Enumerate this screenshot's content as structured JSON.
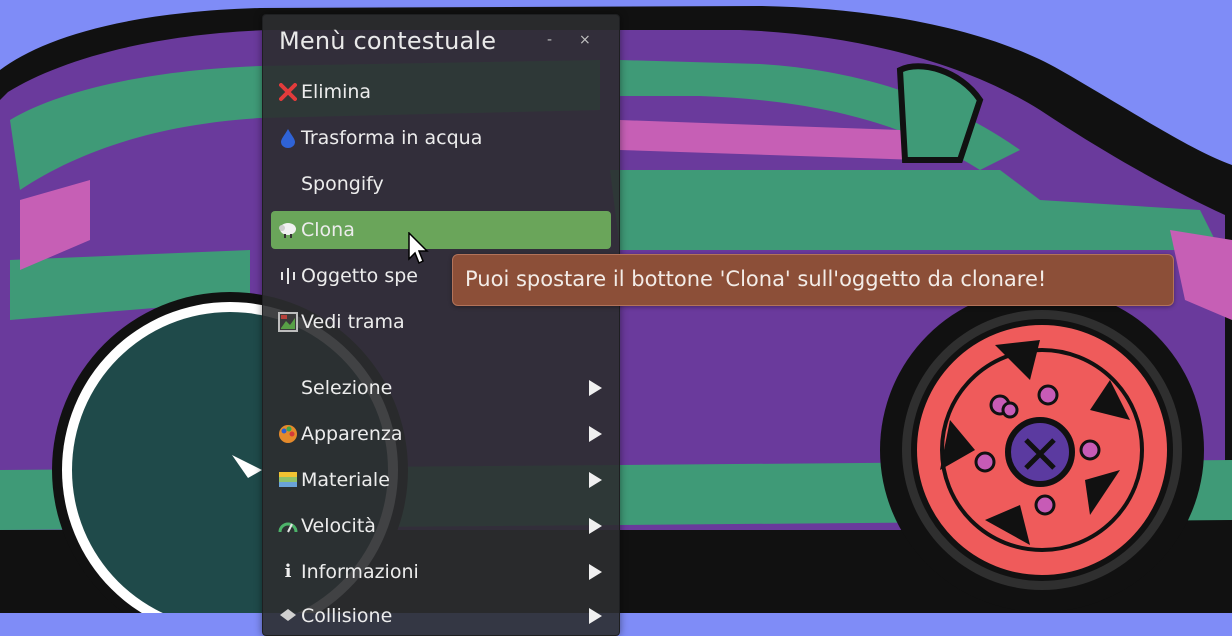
{
  "menu": {
    "title": "Menù contestuale",
    "minimize_glyph": "-",
    "close_glyph": "×",
    "items": [
      {
        "label": "Elimina",
        "icon": "red-x-icon",
        "submenu": false
      },
      {
        "label": "Trasforma in acqua",
        "icon": "water-drop-icon",
        "submenu": false
      },
      {
        "label": "Spongify",
        "icon": "",
        "submenu": false
      },
      {
        "label": "Clona",
        "icon": "clone-sheep-icon",
        "submenu": false,
        "highlighted": true
      },
      {
        "label": "Oggetto spe",
        "icon": "waveform-icon",
        "submenu": false
      },
      {
        "label": "Vedi trama",
        "icon": "texture-icon",
        "submenu": false
      },
      {
        "label": "Selezione",
        "icon": "",
        "submenu": true
      },
      {
        "label": "Apparenza",
        "icon": "palette-icon",
        "submenu": true
      },
      {
        "label": "Materiale",
        "icon": "material-icon",
        "submenu": true
      },
      {
        "label": "Velocità",
        "icon": "speedometer-icon",
        "submenu": true
      },
      {
        "label": "Informazioni",
        "icon": "info-icon",
        "submenu": true
      },
      {
        "label": "Collisione",
        "icon": "collision-icon",
        "submenu": true
      }
    ]
  },
  "tooltip": {
    "text": "Puoi spostare il bottone 'Clona' sull'oggetto da clonare!"
  },
  "colors": {
    "background": "#7f8cf7",
    "menu_bg": "#2c2e30",
    "highlight": "#6aa55a",
    "tooltip_bg": "#8c4f38",
    "car_body": "#6a3a9c",
    "car_trim": "#3f9a77",
    "wheel": "#ef5b5b"
  }
}
